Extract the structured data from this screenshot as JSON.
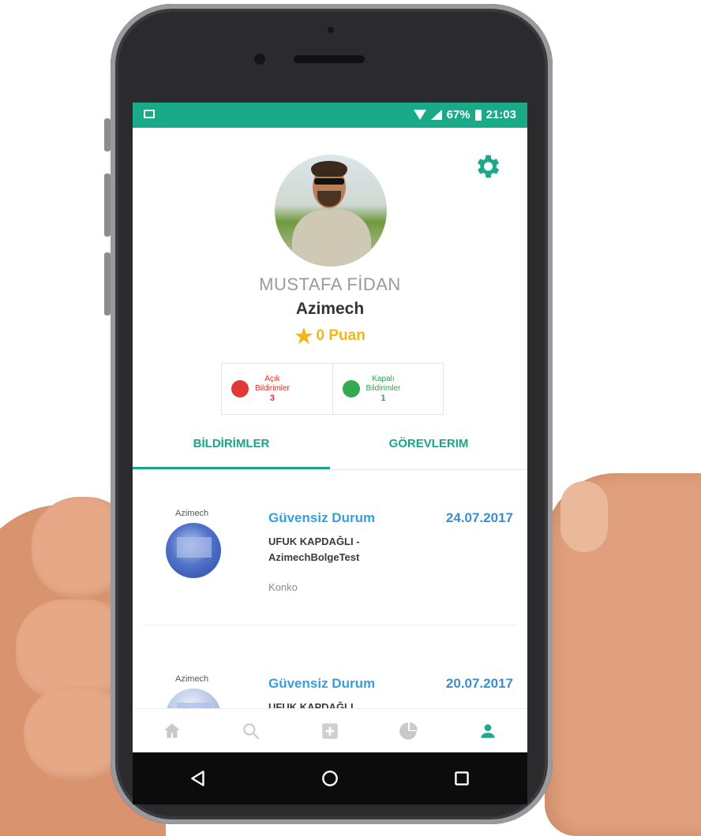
{
  "status_bar": {
    "battery": "67%",
    "time": "21:03"
  },
  "profile": {
    "name": "MUSTAFA FİDAN",
    "company": "Azimech",
    "points": "0 Puan"
  },
  "stats": {
    "open": {
      "label_line1": "Açık",
      "label_line2": "Bildirimler",
      "count": "3",
      "color": "#e03a34"
    },
    "closed": {
      "label_line1": "Kapalı",
      "label_line2": "Bildirimler",
      "count": "1",
      "color": "#34a853"
    }
  },
  "tabs": [
    {
      "label": "BİLDİRİMLER",
      "active": true
    },
    {
      "label": "GÖREVLERIM",
      "active": false
    }
  ],
  "notifications": [
    {
      "thumb_label": "Azimech",
      "title": "Güvensiz Durum",
      "date": "24.07.2017",
      "line1": "UFUK KAPDAĞLI -",
      "line2": "AzimechBolgeTest",
      "meta": "Konko"
    },
    {
      "thumb_label": "Azimech",
      "title": "Güvensiz Durum",
      "date": "20.07.2017",
      "line1": "UFUK KAPDAĞLI"
    }
  ],
  "bottom_nav": [
    "home-icon",
    "search-icon",
    "add-icon",
    "chart-icon",
    "profile-icon"
  ],
  "system_nav": [
    "back-icon",
    "home-circle-icon",
    "recents-icon"
  ],
  "colors": {
    "accent": "#1aa989",
    "title_blue": "#35a0dd",
    "star": "#f2b712"
  }
}
